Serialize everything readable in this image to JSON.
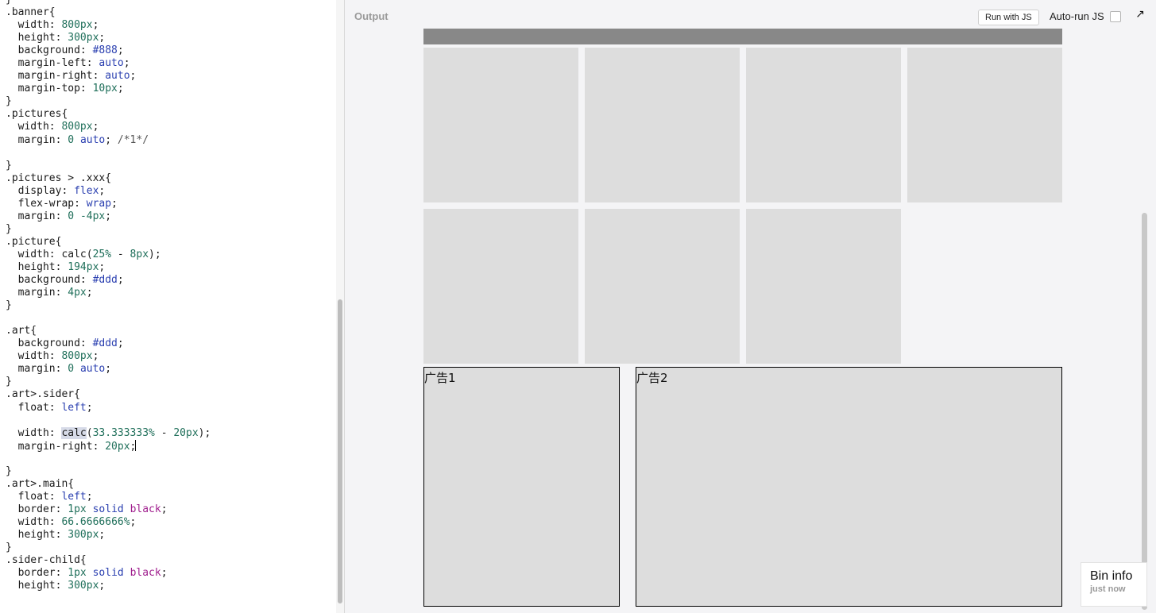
{
  "editor": {
    "lines": [
      "}",
      ".banner{",
      "  width: 800px;",
      "  height: 300px;",
      "  background: #888;",
      "  margin-left: auto;",
      "  margin-right: auto;",
      "  margin-top: 10px;",
      "}",
      ".pictures{",
      "  width: 800px;",
      "  margin: 0 auto; /*1*/",
      "",
      "}",
      ".pictures > .xxx{",
      "  display: flex;",
      "  flex-wrap: wrap;",
      "  margin: 0 -4px;",
      "}",
      ".picture{",
      "  width: calc(25% - 8px);",
      "  height: 194px;",
      "  background: #ddd;",
      "  margin: 4px;",
      "}",
      "",
      ".art{",
      "  background: #ddd;",
      "  width: 800px;",
      "  margin: 0 auto;",
      "}",
      ".art>.sider{",
      "  float: left;",
      "",
      "  width: calc(33.333333% - 20px);",
      "  margin-right: 20px;",
      "",
      "}",
      ".art>.main{",
      "  float: left;",
      "  border: 1px solid black;",
      "  width: 66.6666666%;",
      "  height: 300px;",
      "}",
      ".sider-child{",
      "  border: 1px solid black;",
      "  height: 300px;"
    ],
    "selected_word": "calc",
    "selected_line": 34
  },
  "output": {
    "label": "Output",
    "run_button": "Run with JS",
    "autorun_label": "Auto-run JS",
    "autorun_checked": false,
    "popout_icon": "external-link-icon",
    "picture_count": 7,
    "ad1_label": "广告1",
    "ad2_label": "广告2",
    "banner_color": "#888888",
    "picture_color": "#dddddd"
  },
  "bin_info": {
    "title": "Bin info",
    "subtitle": "just now"
  }
}
